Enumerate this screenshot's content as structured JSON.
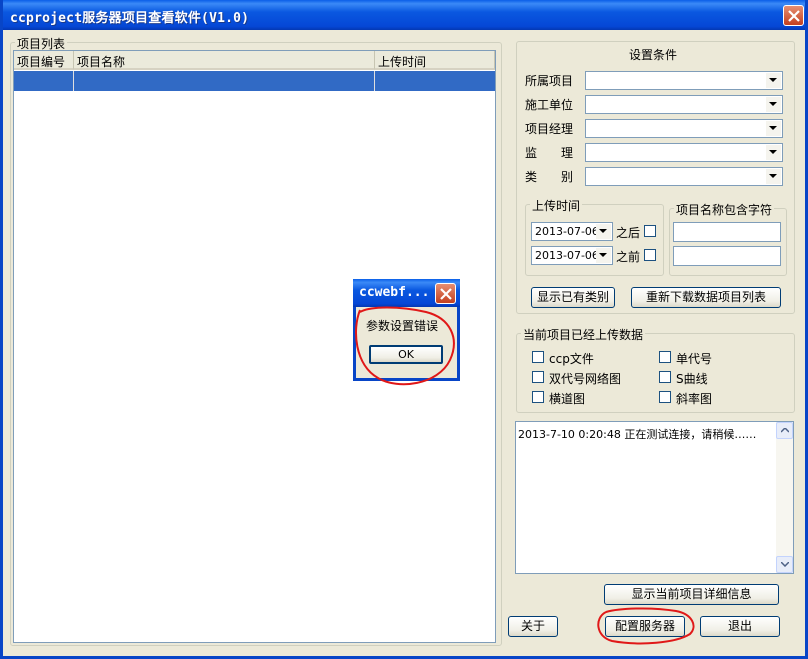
{
  "window": {
    "title": "ccproject服务器项目查看软件(V1.0)"
  },
  "project_list": {
    "legend": "项目列表",
    "columns": [
      "项目编号",
      "项目名称",
      "上传时间"
    ]
  },
  "conditions": {
    "heading": "设置条件",
    "fields": [
      {
        "label": "所属项目",
        "value": ""
      },
      {
        "label": "施工单位",
        "value": ""
      },
      {
        "label": "项目经理",
        "value": ""
      },
      {
        "label": "监　　理",
        "value": ""
      },
      {
        "label": "类　　别",
        "value": ""
      }
    ],
    "upload_time": {
      "legend": "上传时间",
      "after_date": "2013-07-06",
      "after_label": "之后",
      "before_date": "2013-07-06",
      "before_label": "之前"
    },
    "name_contains": {
      "legend": "项目名称包含字符",
      "value1": "",
      "value2": ""
    },
    "show_types_button": "显示已有类别",
    "reload_button": "重新下载数据项目列表"
  },
  "uploaded_data": {
    "legend": "当前项目已经上传数据",
    "items": [
      "ccp文件",
      "单代号",
      "双代号网络图",
      "S曲线",
      "横道图",
      "斜率图"
    ]
  },
  "log": {
    "lines": [
      "2013-7-10 0:20:48  正在测试连接，请稍候……"
    ]
  },
  "buttons": {
    "details": "显示当前项目详细信息",
    "about": "关于",
    "config_server": "配置服务器",
    "exit": "退出"
  },
  "dialog": {
    "title": "ccwebf...",
    "message": "参数设置错误",
    "ok": "OK"
  },
  "colors": {
    "titlebar": "#0a58e0",
    "selection": "#316ac5",
    "annotation": "#e01818"
  }
}
